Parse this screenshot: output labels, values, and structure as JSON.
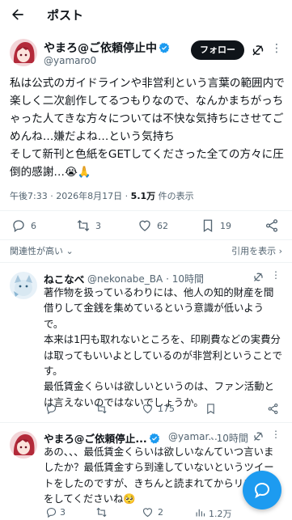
{
  "header": {
    "title": "ポスト"
  },
  "tweet": {
    "name": "やまろ@ご依頼停止中",
    "handle": "@yamaro0",
    "follow_label": "フォロー",
    "body": "私は公式のガイドラインや非営利という言葉の範囲内で楽しく二次創作してるつもりなので、なんかまちがっちゃった人てきな方々については不快な気持ちにさせてごめんね…嫌だよね…という気持ち\nそして新刊と色紙をGETしてくださった全ての方々に圧倒的感謝…😭🙏",
    "time": "午後7:33 · 2026年8月17日 · ",
    "views_count": "5.1万",
    "views_label": " 件の表示",
    "stats": {
      "replies": "6",
      "retweets": "3",
      "likes": "62",
      "bookmarks": "19"
    }
  },
  "sort": {
    "label": "関連性が高い",
    "original_link": "引用を表示 ›"
  },
  "replies": [
    {
      "name": "ねこなべ",
      "handle": "@nekonabe_BA · 10時間",
      "text": "著作物を扱っているわりには、他人の知的財産を間借りして金銭を集めているという意識が低いようで。\n本来は1円も取れないところを、印刷費などの実費分は取ってもいいよとしているのが非営利ということです。\n最低賃金くらいは欲しいというのは、ファン活動とは言えないのではないでしょうか。",
      "stats": {
        "replies": "",
        "retweets": "",
        "likes": "175",
        "bookmarks": ""
      }
    },
    {
      "name": "やまろ@ご依頼停止...",
      "handle": "@yamar...",
      "time": "· 10時間",
      "text": "あの、、、最低賃金くらいは欲しいなんていつ言いましたか？最低賃金すら到達していないというツイートをしたのですが、きちんと読まれてからリプライをしてくださいね🥺",
      "stats": {
        "replies": "3",
        "retweets": "",
        "likes": "2",
        "views": "1.2万"
      }
    }
  ],
  "colors": {
    "accent": "#1d9bf0",
    "text": "#0f1419",
    "muted": "#536471"
  }
}
